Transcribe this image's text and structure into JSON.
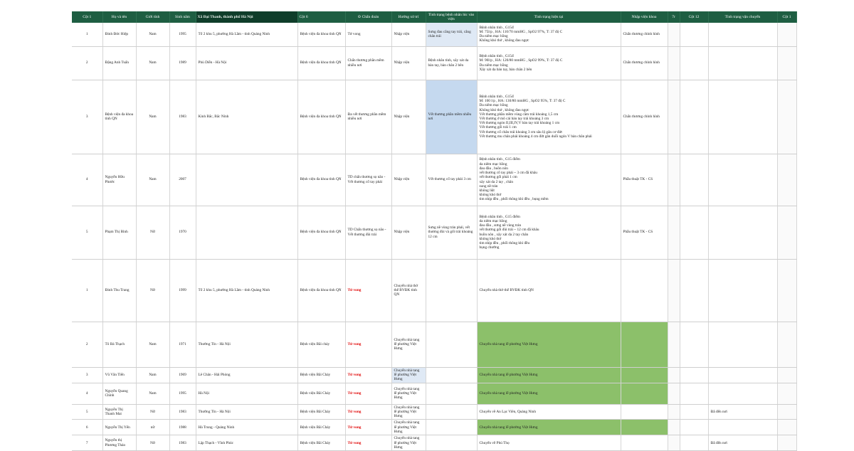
{
  "headers": [
    "Cột 1",
    "Họ và tên",
    "Giới tính",
    "Sinh năm",
    "Xã Đại Thanh, thành phố Hà Nội",
    "Cột 6",
    "⊙    Chẩn đoán",
    "Hướng xử trí",
    "Tình trạng bệnh nhân lúc vào viện",
    "Tình trạng hiện tại",
    "Nhập viện khoa",
    "7r",
    "Cột 12",
    "Tình trạng vận chuyển",
    "Cột 1"
  ],
  "rows": [
    {
      "stt": "1",
      "name": "Đinh Đức Hiệp",
      "gender": "Nam",
      "year": "1995",
      "address": "Tổ 2 khu 5, phường Hà Lầm - tỉnh Quảng Ninh",
      "hospital": "Bệnh viện đa khoa tỉnh QN",
      "diagnosis": "Tử vong",
      "treatment": "Nhập viện",
      "admission": "Sưng đau cẳng tay trái, cẳng chân trái",
      "current": "Bệnh nhân tỉnh , G15đ\nM: 75l/p , HA: 110/70 mmHG , SpO2 97%, T: 37 độ C\nDa niêm mạc hồng\nKhông khó thở , không đau ngực",
      "dept": "Chấn thương chỉnh hình",
      "c12": "",
      "transport": ""
    },
    {
      "stt": "2",
      "name": "Đặng Anh Tuấn",
      "gender": "Nam",
      "year": "1989",
      "address": "Phù Diễn - Hà Nội",
      "hospital": "Bệnh viện đa khoa tỉnh QN",
      "diagnosis": "Chấn thương phần mềm nhiều nơi",
      "treatment": "Nhập viện",
      "admission": "Bệnh nhân tỉnh, xây xát da bàn tay, bàn chân 2 bên",
      "current": "Bệnh nhân tỉnh , G15đ\nM: 90l/p , HA: 120/80 mmHG , SpO2 99%, T: 37 độ C\nDa niêm mạc hồng\nXây xát da bàn tay, bàn chân 2 bên",
      "dept": "Chấn thương chỉnh hình",
      "c12": "",
      "transport": ""
    },
    {
      "stt": "3",
      "name": "Bệnh viện đa khoa tỉnh QN",
      "gender": "Nam",
      "year": "1983",
      "address": "Kinh Bắc, Bắc Ninh",
      "hospital": "Bệnh viện đa khoa tỉnh QN",
      "diagnosis": "Đa vết thương phần mềm nhiều nơi",
      "treatment": "Nhập viện",
      "admission": "Vết thương phần mềm nhiều nơi",
      "current": "Bệnh nhân tỉnh , G15đ\nM: 100 l/p , HA: 130/80 mmHG , SpO2 95%, T: 37 độ C\nDa niêm mạc hồng\nKhông khó thở , không đau ngực\nVết thương phần mềm vùng cằm trái khoảng 1,5 cm\nVết thương ở mô cái bàn tay trái khoảng 3 cm\nVết thương ngón II,III,IV,V bàn tay trái khoảng 1 cm\nVết thương gối trái 1 cm\nVết thương cổ chân trái khoảng 3 cm sâu lộ gân cơ đứt\nVết thương mu chân phải khoảng 4 cm đứt gân duỗi ngón V bàn chân phải",
      "dept": "Chấn thương chỉnh hình",
      "c12": "",
      "transport": ""
    },
    {
      "stt": "4",
      "name": "Nguyễn Hữu Phước",
      "gender": "Nam",
      "year": "2007",
      "address": "",
      "hospital": "Bệnh viện đa khoa tỉnh QN",
      "diagnosis": "TD chấn thương sọ não - Vết thương cổ tay phải",
      "treatment": "Nhập viện",
      "admission": "Vết thương cổ tay phải 3 cm",
      "current": "Bệnh nhân tỉnh , G15 điểm\nda niêm mạc hồng\nđau đầu , buồn nôn\nvết thương cổ tay phải ~ 3 cm đã khâu\nvết thương gối phải 1 cm\nxây xát da 2 tay , chân\nsung nề trán\nkhông liệt\nkhông khó thở\ntim nhịp đều , phổi thông khí đều , bụng mềm",
      "dept": "Phẫu thuật TK - CS",
      "c12": "",
      "transport": ""
    },
    {
      "stt": "5",
      "name": "Phạm Thị Bình",
      "gender": "Nữ",
      "year": "1970",
      "address": "",
      "hospital": "Bệnh viện đa khoa tỉnh QN",
      "diagnosis": "TD Chấn thương sọ não - Vết thương đùi trái",
      "treatment": "Nhập viện",
      "admission": "Sưng nề vùng trán phải, vết thương đùi và gối trái khoảng 12 cm",
      "current": "Bệnh nhân tỉnh , G15 điểm\nda niêm mạc hồng\nđau đầu , sưng nề vùng trán\nvết thương gối đùi trái ~ 12 cm đã khâu\nbuồn nôn , xây xát da 2 tay chân\nkhông khó thở\ntim nhịp đều , phổi thông khí đều\nbụng chướng",
      "dept": "Phẫu thuật TK - CS",
      "c12": "",
      "transport": ""
    },
    {
      "stt": "1",
      "name": "Đinh Thu Trang",
      "gender": "Nữ",
      "year": "1999",
      "address": "Tổ 2 khu 5, phường Hà Lầm - tỉnh Quảng Ninh",
      "hospital": "Bệnh viện đa khoa tỉnh QN",
      "diagnosis": "Tử vong",
      "treatment": "Chuyển nhà thờ thể BVĐK tỉnh QN",
      "admission": "",
      "current": "Chuyển nhà thờ thể BVĐK tỉnh QN",
      "dept": "",
      "c12": "",
      "transport": ""
    },
    {
      "stt": "2",
      "name": "Tô Bá Thạch",
      "gender": "Nam",
      "year": "1971",
      "address": "Thường Tín - Hà Nội",
      "hospital": "Bệnh viện Bãi cháy",
      "diagnosis": "Tử vong",
      "treatment": "Chuyển nhà tang lễ phường Việt Hưng",
      "admission": "",
      "current": "Chuyển nhà tang lễ phường Việt Hưng",
      "dept": "",
      "c12": "",
      "transport": ""
    },
    {
      "stt": "3",
      "name": "Vũ Văn Tiến",
      "gender": "Nam",
      "year": "1969",
      "address": "Lê Chân - Hải Phòng",
      "hospital": "Bệnh viện Bãi Cháy",
      "diagnosis": "Tử vong",
      "treatment": "Chuyển nhà tang lễ phường Việt Hưng",
      "admission": "",
      "current": "Chuyển nhà tang lễ phường Việt Hưng",
      "dept": "",
      "c12": "",
      "transport": ""
    },
    {
      "stt": "4",
      "name": "Nguyễn Quang Chính",
      "gender": "Nam",
      "year": "1995",
      "address": "Hà Nội",
      "hospital": "Bệnh viện Bãi Cháy",
      "diagnosis": "Tử vong",
      "treatment": "Chuyển nhà tang lễ phường Việt Hưng",
      "admission": "",
      "current": "Chuyển nhà tang lễ phường Việt Hưng",
      "dept": "",
      "c12": "",
      "transport": ""
    },
    {
      "stt": "5",
      "name": "Nguyễn Thị Thanh Mai",
      "gender": "Nữ",
      "year": "1983",
      "address": "Thường Tín - Hà Nội",
      "hospital": "Bệnh viện Bãi Cháy",
      "diagnosis": "Tử vong",
      "treatment": "Chuyển nhà tang lễ phường Việt Hưng",
      "admission": "",
      "current": "Chuyển về An Lạc Viên, Quảng Ninh",
      "dept": "",
      "c12": "",
      "transport": "Đã đến nơi"
    },
    {
      "stt": "6",
      "name": "Nguyễn Thị Yến",
      "gender": "nữ",
      "year": "1988",
      "address": "Hà Trung - Quảng Ninh",
      "hospital": "Bệnh viện Bãi Cháy",
      "diagnosis": "Tử vong",
      "treatment": "Chuyển nhà tang lễ phường Việt Hưng",
      "admission": "",
      "current": "Chuyển nhà tang lễ phường Việt Hưng",
      "dept": "",
      "c12": "",
      "transport": ""
    },
    {
      "stt": "7",
      "name": "Nguyễn thị Phương Thảo",
      "gender": "Nữ",
      "year": "1983",
      "address": "Lập Thạch - Vĩnh Phúc",
      "hospital": "Bệnh viện Bãi Cháy",
      "diagnosis": "Tử vong",
      "treatment": "Chuyển nhà tang lễ phường Việt Hưng",
      "admission": "",
      "current": "Chuyển về Phú Thọ",
      "dept": "",
      "c12": "",
      "transport": "Đã đến nơi"
    }
  ],
  "colors": {
    "header": "#1e5e42",
    "death_text": "#e00000",
    "admission_highlight": "#c5d9ef",
    "status_highlight": "#8cc06a"
  }
}
